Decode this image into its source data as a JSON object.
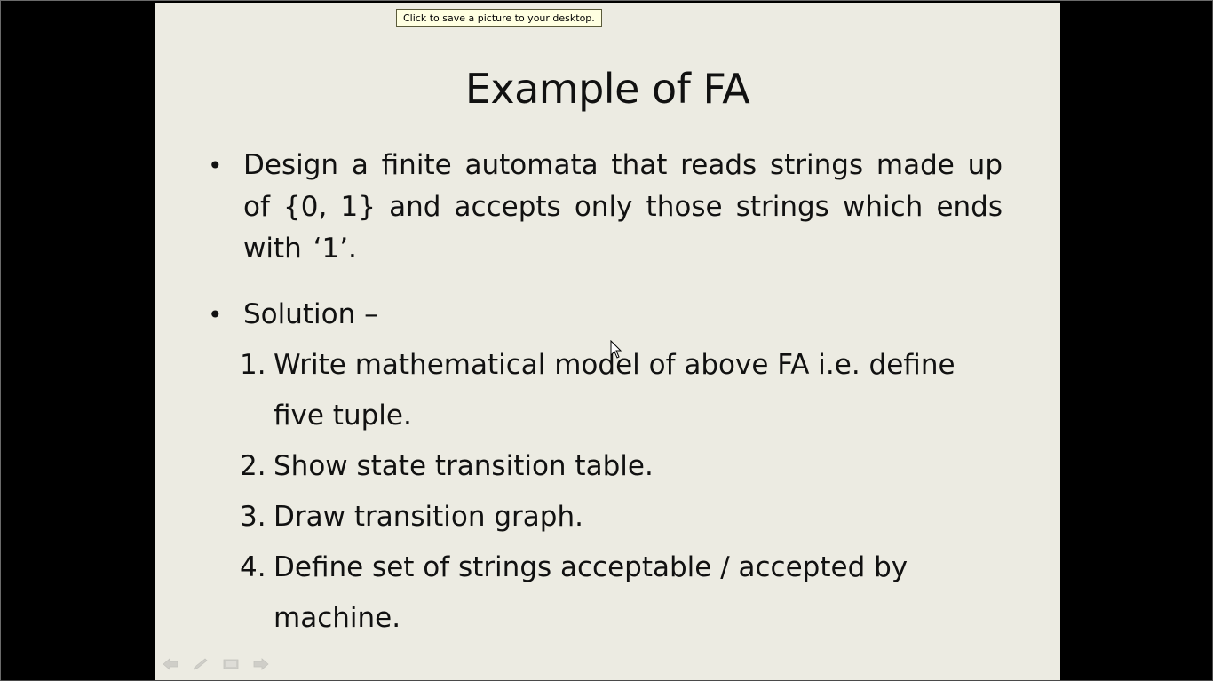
{
  "tooltip": {
    "text": "Click to save a picture to your desktop."
  },
  "slide": {
    "title": "Example of FA",
    "bullets": [
      {
        "marker": "•",
        "text": "Design a finite automata that reads strings made up of {0, 1} and accepts only those strings which ends with ‘1’."
      },
      {
        "marker": "•",
        "text": "Solution –"
      }
    ],
    "steps": [
      {
        "num": "1.",
        "text": "Write mathematical model of above FA i.e. define five tuple."
      },
      {
        "num": "2.",
        "text": "Show state transition table."
      },
      {
        "num": "3.",
        "text": "Draw transition graph."
      },
      {
        "num": "4.",
        "text": "Define set of strings acceptable / accepted by machine."
      }
    ]
  },
  "slideshow_controls": {
    "icons": [
      "previous-slide-icon",
      "pen-icon",
      "slide-menu-icon",
      "next-slide-icon"
    ]
  },
  "colors": {
    "slide_background": "#ecebe2",
    "screen_background": "#000000",
    "tooltip_background": "#ffffe1",
    "text": "#111111"
  }
}
